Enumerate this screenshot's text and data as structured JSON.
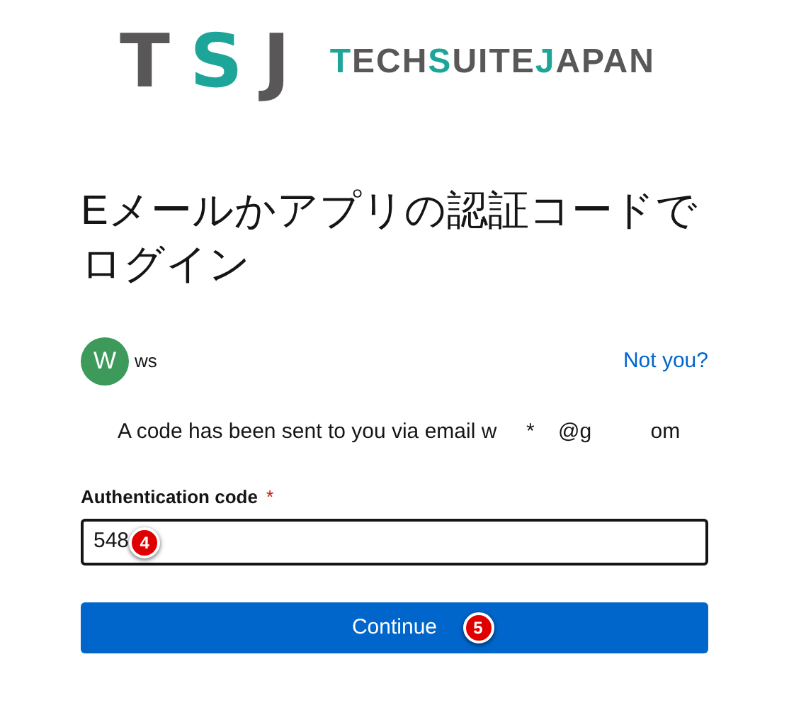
{
  "logo": {
    "mark": [
      {
        "text": "T",
        "accent": false
      },
      {
        "text": "S",
        "accent": true
      },
      {
        "text": "J",
        "accent": false
      }
    ],
    "wordmark": [
      {
        "text": "T",
        "accent": true
      },
      {
        "text": "ECH",
        "accent": false
      },
      {
        "text": "S",
        "accent": true
      },
      {
        "text": "UITE",
        "accent": false
      },
      {
        "text": "J",
        "accent": true
      },
      {
        "text": "APAN",
        "accent": false
      }
    ]
  },
  "heading": "Eメールかアプリの認証コードでログイン",
  "user": {
    "avatar": "W",
    "name": "ws",
    "link": "Not you?"
  },
  "message": "A code has been sent to you via email w     *    @g          om",
  "field": {
    "label": "Authentication code",
    "required_mark": "*",
    "value": "548",
    "badge": "4"
  },
  "button": {
    "label": "Continue",
    "badge": "5"
  }
}
